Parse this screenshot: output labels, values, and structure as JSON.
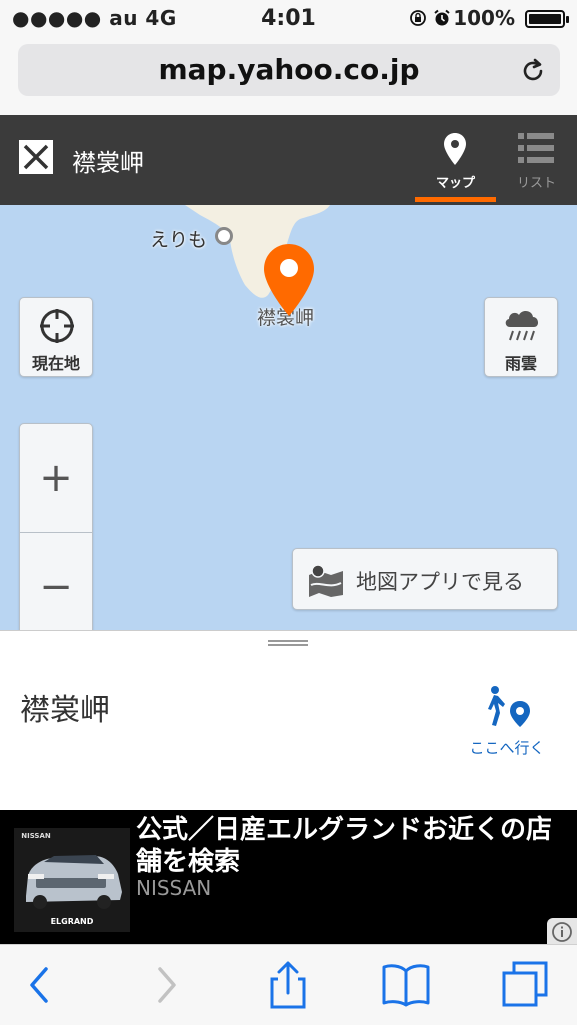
{
  "status_bar": {
    "carrier": "●●●●● au  4G",
    "time": "4:01",
    "battery": "100%"
  },
  "browser": {
    "url": "map.yahoo.co.jp"
  },
  "header": {
    "title": "襟裳岬",
    "tabs": [
      {
        "label": "マップ",
        "active": true
      },
      {
        "label": "リスト",
        "active": false
      }
    ]
  },
  "map": {
    "labels": {
      "erimo": "えりも",
      "cape": "襟裳岬"
    },
    "buttons": {
      "current_location": "現在地",
      "rain_cloud": "雨雲",
      "zoom_in": "+",
      "zoom_out": "−",
      "open_app": "地図アプリで見る"
    },
    "colors": {
      "water": "#b9d5f2",
      "land": "#f3efe2",
      "marker": "#ff6a00"
    }
  },
  "sheet": {
    "title": "襟裳岬",
    "go_here": "ここへ行く"
  },
  "ad": {
    "headline": "公式／日産エルグランドお近くの店舗を検索",
    "advertiser": "NISSAN",
    "image_text": {
      "brand": "NISSAN",
      "model": "ELGRAND"
    }
  },
  "toolbar": {
    "icons": [
      "back-icon",
      "forward-icon",
      "share-icon",
      "bookmarks-icon",
      "tabs-icon"
    ],
    "accent": "#1a73e8"
  }
}
